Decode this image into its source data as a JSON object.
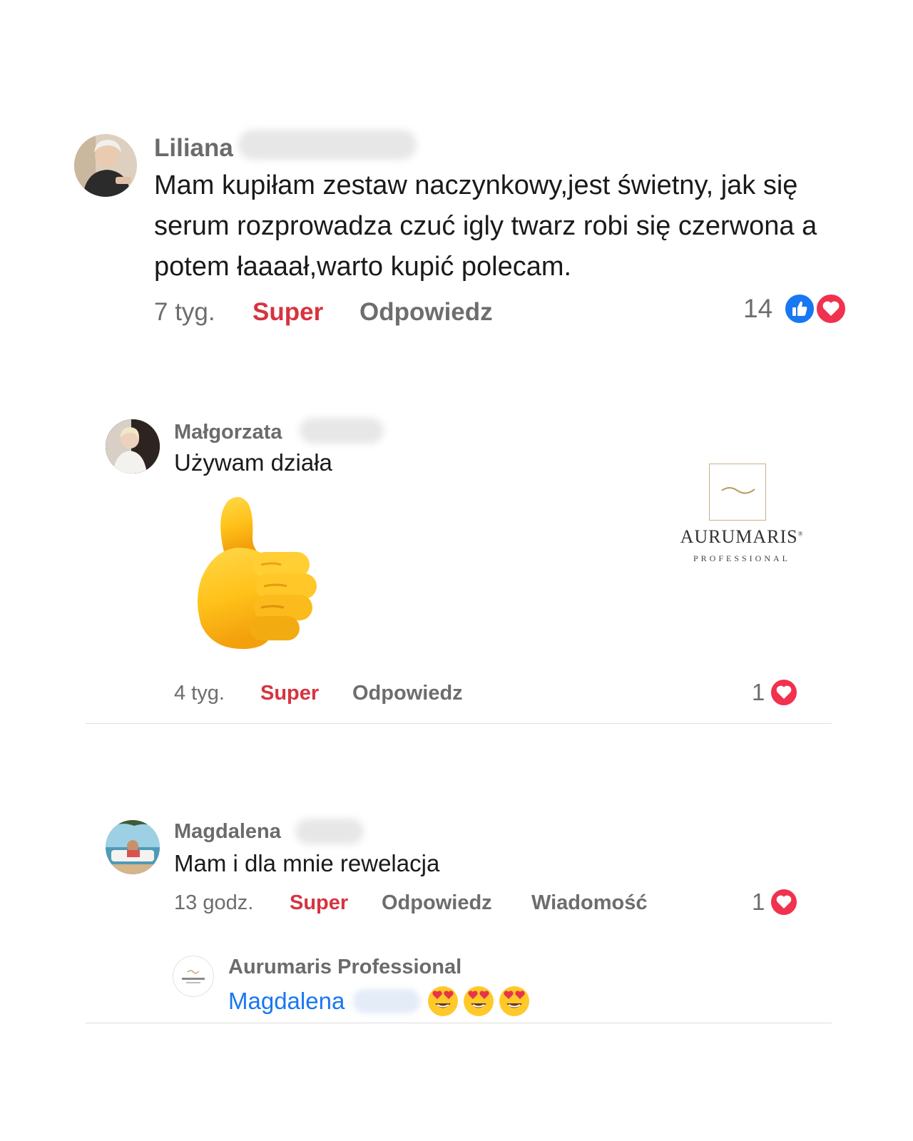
{
  "brand": {
    "name": "AURUMARIS",
    "registered": "®",
    "tagline": "PROFESSIONAL"
  },
  "colors": {
    "super": "#d7333f",
    "link": "#1877f2",
    "gold": "#b8995a"
  },
  "comments": [
    {
      "author": "Liliana",
      "text": "Mam kupiłam zestaw naczynkowy,jest świetny, jak się serum rozprowadza czuć igly twarz robi się czerwona a potem łaaaał,warto kupić polecam.",
      "time": "7 tyg.",
      "super_label": "Super",
      "reply_label": "Odpowiedz",
      "reaction_count": "14",
      "reactions": [
        "like-icon",
        "love-icon"
      ]
    },
    {
      "author": "Małgorzata",
      "text": "Używam działa",
      "sticker": "thumbs-up-sticker",
      "time": "4 tyg.",
      "super_label": "Super",
      "reply_label": "Odpowiedz",
      "reaction_count": "1",
      "reactions": [
        "love-icon"
      ]
    },
    {
      "author": "Magdalena",
      "text": "Mam i dla mnie rewelacja",
      "time": "13 godz.",
      "super_label": "Super",
      "reply_label": "Odpowiedz",
      "message_label": "Wiadomość",
      "reaction_count": "1",
      "reactions": [
        "love-icon"
      ]
    }
  ],
  "reply": {
    "author": "Aurumaris Professional",
    "mention": "Magdalena",
    "emojis": [
      "heart-eyes-emoji",
      "heart-eyes-emoji",
      "heart-eyes-emoji"
    ]
  }
}
